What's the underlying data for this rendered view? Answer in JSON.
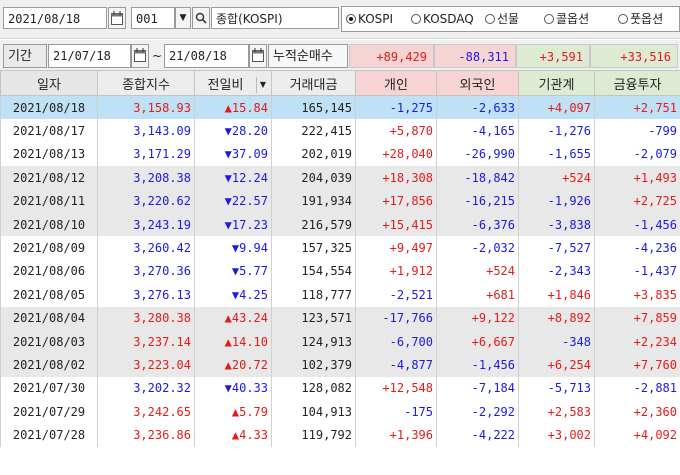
{
  "toolbar": {
    "date": "2021/08/18",
    "code": "001",
    "index_name": "종합(KOSPI)",
    "radios": [
      {
        "label": "KOSPI",
        "selected": true
      },
      {
        "label": "KOSDAQ",
        "selected": false
      },
      {
        "label": "선물",
        "selected": false
      },
      {
        "label": "콜옵션",
        "selected": false
      },
      {
        "label": "풋옵션",
        "selected": false
      }
    ]
  },
  "period": {
    "label": "기간",
    "start": "21/07/18",
    "sep": "~",
    "end": "21/08/18",
    "mode_label": "누적순매수",
    "totals": [
      "+89,429",
      "-88,311",
      "+3,591",
      "+33,516"
    ]
  },
  "table": {
    "headers": [
      "일자",
      "종합지수",
      "전일비",
      "거래대금",
      "개인",
      "외국인",
      "기관계",
      "금융투자"
    ],
    "rows": [
      {
        "date": "2021/08/18",
        "index": "3,158.93",
        "dir": "up",
        "chg": "15.84",
        "amount": "165,145",
        "indiv": "-1,275",
        "foreign": "-2,633",
        "inst": "+4,097",
        "fin": "+2,751",
        "style": "sel"
      },
      {
        "date": "2021/08/17",
        "index": "3,143.09",
        "dir": "down",
        "chg": "28.20",
        "amount": "222,415",
        "indiv": "+5,870",
        "foreign": "-4,165",
        "inst": "-1,276",
        "fin": "-799",
        "style": "white"
      },
      {
        "date": "2021/08/13",
        "index": "3,171.29",
        "dir": "down",
        "chg": "37.09",
        "amount": "202,019",
        "indiv": "+28,040",
        "foreign": "-26,990",
        "inst": "-1,655",
        "fin": "-2,079",
        "style": "white"
      },
      {
        "date": "2021/08/12",
        "index": "3,208.38",
        "dir": "down",
        "chg": "12.24",
        "amount": "204,039",
        "indiv": "+18,308",
        "foreign": "-18,842",
        "inst": "+524",
        "fin": "+1,493",
        "style": "gray"
      },
      {
        "date": "2021/08/11",
        "index": "3,220.62",
        "dir": "down",
        "chg": "22.57",
        "amount": "191,934",
        "indiv": "+17,856",
        "foreign": "-16,215",
        "inst": "-1,926",
        "fin": "+2,725",
        "style": "gray"
      },
      {
        "date": "2021/08/10",
        "index": "3,243.19",
        "dir": "down",
        "chg": "17.23",
        "amount": "216,579",
        "indiv": "+15,415",
        "foreign": "-6,376",
        "inst": "-3,838",
        "fin": "-1,456",
        "style": "gray"
      },
      {
        "date": "2021/08/09",
        "index": "3,260.42",
        "dir": "down",
        "chg": "9.94",
        "amount": "157,325",
        "indiv": "+9,497",
        "foreign": "-2,032",
        "inst": "-7,527",
        "fin": "-4,236",
        "style": "white"
      },
      {
        "date": "2021/08/06",
        "index": "3,270.36",
        "dir": "down",
        "chg": "5.77",
        "amount": "154,554",
        "indiv": "+1,912",
        "foreign": "+524",
        "inst": "-2,343",
        "fin": "-1,437",
        "style": "white"
      },
      {
        "date": "2021/08/05",
        "index": "3,276.13",
        "dir": "down",
        "chg": "4.25",
        "amount": "118,777",
        "indiv": "-2,521",
        "foreign": "+681",
        "inst": "+1,846",
        "fin": "+3,835",
        "style": "white"
      },
      {
        "date": "2021/08/04",
        "index": "3,280.38",
        "dir": "up",
        "chg": "43.24",
        "amount": "123,571",
        "indiv": "-17,766",
        "foreign": "+9,122",
        "inst": "+8,892",
        "fin": "+7,859",
        "style": "gray"
      },
      {
        "date": "2021/08/03",
        "index": "3,237.14",
        "dir": "up",
        "chg": "14.10",
        "amount": "124,913",
        "indiv": "-6,700",
        "foreign": "+6,667",
        "inst": "-348",
        "fin": "+2,234",
        "style": "gray"
      },
      {
        "date": "2021/08/02",
        "index": "3,223.04",
        "dir": "up",
        "chg": "20.72",
        "amount": "102,379",
        "indiv": "-4,877",
        "foreign": "-1,456",
        "inst": "+6,254",
        "fin": "+7,760",
        "style": "gray"
      },
      {
        "date": "2021/07/30",
        "index": "3,202.32",
        "dir": "down",
        "chg": "40.33",
        "amount": "128,082",
        "indiv": "+12,548",
        "foreign": "-7,184",
        "inst": "-5,713",
        "fin": "-2,881",
        "style": "white"
      },
      {
        "date": "2021/07/29",
        "index": "3,242.65",
        "dir": "up",
        "chg": "5.79",
        "amount": "104,913",
        "indiv": "-175",
        "foreign": "-2,292",
        "inst": "+2,583",
        "fin": "+2,360",
        "style": "white"
      },
      {
        "date": "2021/07/28",
        "index": "3,236.86",
        "dir": "up",
        "chg": "4.33",
        "amount": "119,792",
        "indiv": "+1,396",
        "foreign": "-4,222",
        "inst": "+3,002",
        "fin": "+4,092",
        "style": "white"
      }
    ]
  },
  "colors": {
    "up": "#e31b1b",
    "down": "#1a1ae0",
    "selected": "#bfe1f6",
    "alt": "#e8e8e8"
  }
}
